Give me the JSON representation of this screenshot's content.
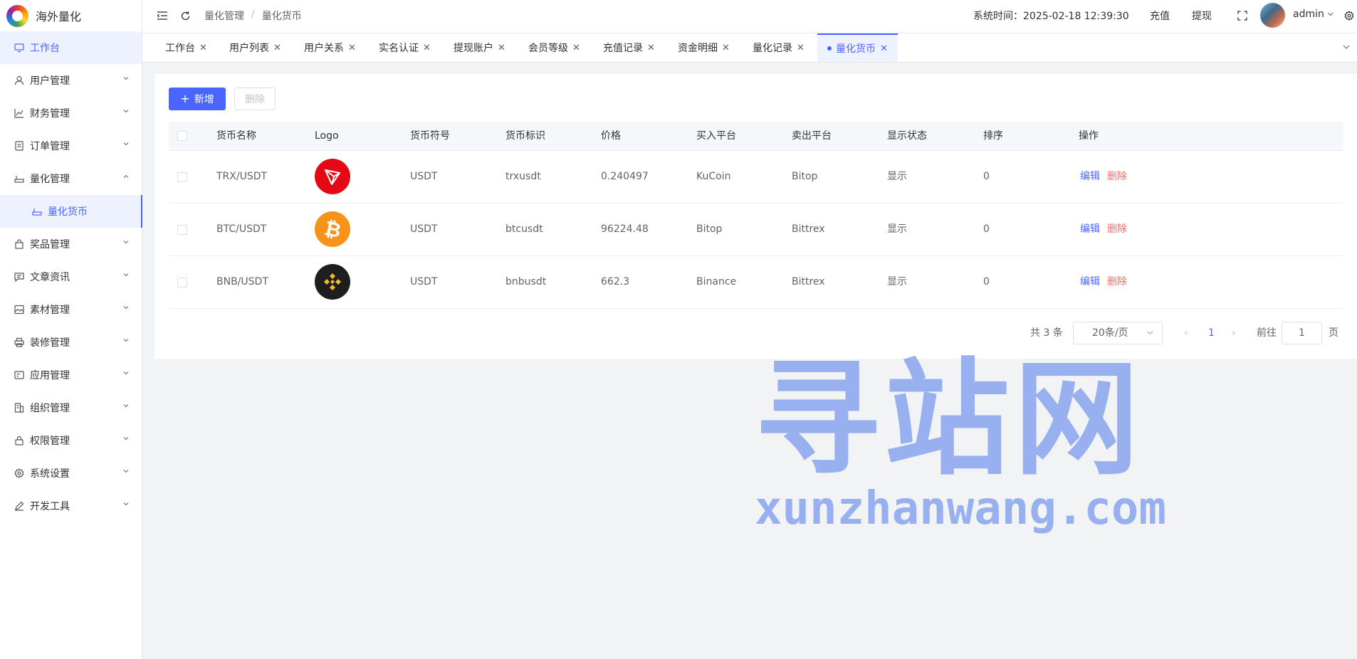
{
  "brand": {
    "name": "海外量化"
  },
  "sidebar": {
    "items": [
      {
        "label": "工作台",
        "icon": "monitor-icon"
      },
      {
        "label": "用户管理",
        "icon": "user-icon"
      },
      {
        "label": "财务管理",
        "icon": "chart-icon"
      },
      {
        "label": "订单管理",
        "icon": "order-icon"
      },
      {
        "label": "量化管理",
        "icon": "quant-icon"
      },
      {
        "label": "量化货币",
        "icon": "quant-icon"
      },
      {
        "label": "奖品管理",
        "icon": "bag-icon"
      },
      {
        "label": "文章资讯",
        "icon": "message-icon"
      },
      {
        "label": "素材管理",
        "icon": "image-icon"
      },
      {
        "label": "装修管理",
        "icon": "printer-icon"
      },
      {
        "label": "应用管理",
        "icon": "app-icon"
      },
      {
        "label": "组织管理",
        "icon": "building-icon"
      },
      {
        "label": "权限管理",
        "icon": "lock-icon"
      },
      {
        "label": "系统设置",
        "icon": "gear-icon"
      },
      {
        "label": "开发工具",
        "icon": "pen-icon"
      }
    ]
  },
  "header": {
    "breadcrumb": [
      "量化管理",
      "量化货币"
    ],
    "breadcrumb_sep": "/",
    "system_time": "系统时间：2025-02-18 12:39:30",
    "recharge": "充值",
    "withdraw": "提现",
    "user": "admin"
  },
  "tabs": [
    {
      "label": "工作台"
    },
    {
      "label": "用户列表"
    },
    {
      "label": "用户关系"
    },
    {
      "label": "实名认证"
    },
    {
      "label": "提现账户"
    },
    {
      "label": "会员等级"
    },
    {
      "label": "充值记录"
    },
    {
      "label": "资金明细"
    },
    {
      "label": "量化记录"
    },
    {
      "label": "量化货币"
    }
  ],
  "toolbar": {
    "add_label": "新增",
    "delete_label": "删除"
  },
  "table": {
    "headers": [
      "货币名称",
      "Logo",
      "货币符号",
      "货币标识",
      "价格",
      "买入平台",
      "卖出平台",
      "显示状态",
      "排序",
      "操作"
    ],
    "rows": [
      {
        "name": "TRX/USDT",
        "symbol": "USDT",
        "code": "trxusdt",
        "price": "0.240497",
        "buy": "KuCoin",
        "sell": "Bitop",
        "status": "显示",
        "sort": "0",
        "logo": "tron-icon",
        "logo_color": "#e50915"
      },
      {
        "name": "BTC/USDT",
        "symbol": "USDT",
        "code": "btcusdt",
        "price": "96224.48",
        "buy": "Bitop",
        "sell": "Bittrex",
        "status": "显示",
        "sort": "0",
        "logo": "bitcoin-icon",
        "logo_color": "#f7931a"
      },
      {
        "name": "BNB/USDT",
        "symbol": "USDT",
        "code": "bnbusdt",
        "price": "662.3",
        "buy": "Binance",
        "sell": "Bittrex",
        "status": "显示",
        "sort": "0",
        "logo": "binance-icon",
        "logo_color": "#1e1e1e"
      }
    ],
    "edit_label": "编辑",
    "delete_label": "删除"
  },
  "pagination": {
    "total": "共 3 条",
    "page_size": "20条/页",
    "current": "1",
    "goto_label": "前往",
    "goto_value": "1",
    "goto_unit": "页"
  },
  "watermark": {
    "title": "寻站网",
    "url": "xunzhanwang.com"
  },
  "colors": {
    "primary": "#4a64ff",
    "danger": "#f56c6c",
    "watermark": "#8fa9ef"
  }
}
